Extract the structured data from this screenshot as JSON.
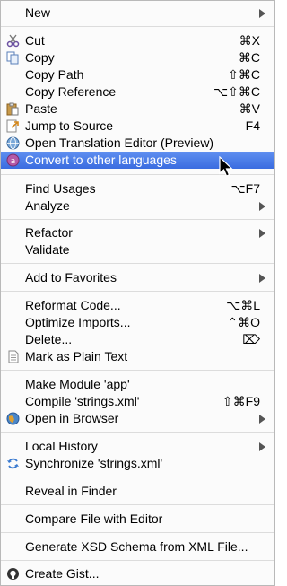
{
  "menu": {
    "items": [
      {
        "label": "New",
        "submenu": true
      },
      {
        "label": "Cut",
        "shortcut": "⌘X",
        "icon": "scissors-icon"
      },
      {
        "label": "Copy",
        "shortcut": "⌘C",
        "icon": "copy-icon"
      },
      {
        "label": "Copy Path",
        "shortcut": "⇧⌘C"
      },
      {
        "label": "Copy Reference",
        "shortcut": "⌥⇧⌘C"
      },
      {
        "label": "Paste",
        "shortcut": "⌘V",
        "icon": "paste-icon"
      },
      {
        "label": "Jump to Source",
        "shortcut": "F4",
        "icon": "jump-to-source-icon"
      },
      {
        "label": "Open Translation Editor (Preview)",
        "icon": "globe-icon"
      },
      {
        "label": "Convert to other languages",
        "icon": "translate-icon",
        "highlighted": true
      },
      {
        "label": "Find Usages",
        "shortcut": "⌥F7"
      },
      {
        "label": "Analyze",
        "submenu": true
      },
      {
        "label": "Refactor",
        "submenu": true
      },
      {
        "label": "Validate"
      },
      {
        "label": "Add to Favorites",
        "submenu": true
      },
      {
        "label": "Reformat Code...",
        "shortcut": "⌥⌘L"
      },
      {
        "label": "Optimize Imports...",
        "shortcut": "⌃⌘O"
      },
      {
        "label": "Delete...",
        "shortcut": "⌦"
      },
      {
        "label": "Mark as Plain Text",
        "icon": "plain-text-icon"
      },
      {
        "label": "Make Module 'app'"
      },
      {
        "label": "Compile 'strings.xml'",
        "shortcut": "⇧⌘F9"
      },
      {
        "label": "Open in Browser",
        "icon": "browser-globe-icon",
        "submenu": true
      },
      {
        "label": "Local History",
        "submenu": true
      },
      {
        "label": "Synchronize 'strings.xml'",
        "icon": "sync-icon"
      },
      {
        "label": "Reveal in Finder"
      },
      {
        "label": "Compare File with Editor"
      },
      {
        "label": "Generate XSD Schema from XML File..."
      },
      {
        "label": "Create Gist...",
        "icon": "github-icon"
      }
    ]
  },
  "colors": {
    "highlight": "#3a6ce0",
    "separator": "#dcdcdc",
    "background": "#fbfbfb"
  }
}
